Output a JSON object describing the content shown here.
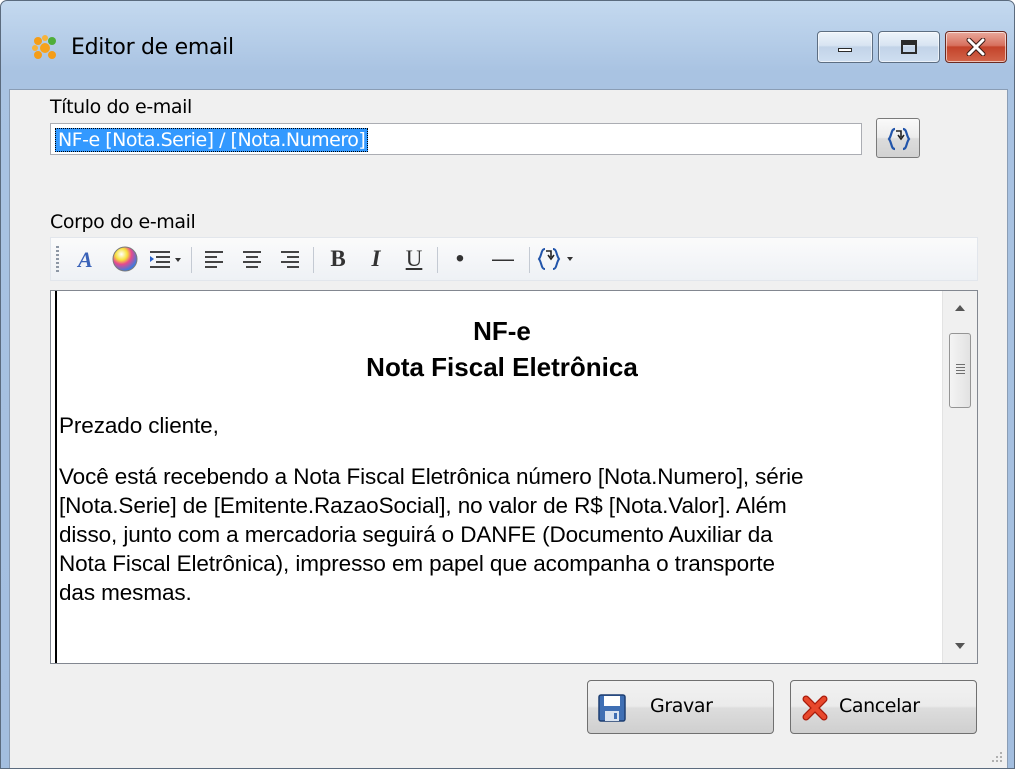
{
  "window": {
    "title": "Editor de email"
  },
  "subject": {
    "label": "Título do e-mail",
    "value": "NF-e [Nota.Serie] / [Nota.Numero]"
  },
  "body": {
    "label": "Corpo do e-mail",
    "heading_line1": "NF-e",
    "heading_line2": "Nota Fiscal Eletrônica",
    "greeting": "Prezado cliente,",
    "paragraph_lines": [
      "Você está recebendo a Nota Fiscal Eletrônica número [Nota.Numero], série",
      "[Nota.Serie] de [Emitente.RazaoSocial], no valor de R$ [Nota.Valor]. Além",
      "disso, junto com a mercadoria seguirá o DANFE (Documento Auxiliar da",
      "Nota Fiscal Eletrônica), impresso em papel que acompanha o transporte",
      "das mesmas."
    ]
  },
  "toolbar": {
    "bold_label": "B",
    "italic_label": "I",
    "underline_label": "U",
    "bullet_label": "•",
    "hr_label": "—"
  },
  "buttons": {
    "save": "Gravar",
    "cancel": "Cancelar"
  },
  "icons": [
    "app-icon",
    "minimize-icon",
    "maximize-icon",
    "close-icon",
    "insert-variable-icon",
    "font-icon",
    "color-icon",
    "indent-icon",
    "align-left-icon",
    "align-center-icon",
    "align-right-icon",
    "save-icon",
    "cancel-icon"
  ],
  "colors": {
    "title_bar": "#b5cde8",
    "selection": "#3399ff",
    "close_button": "#c3432b"
  }
}
